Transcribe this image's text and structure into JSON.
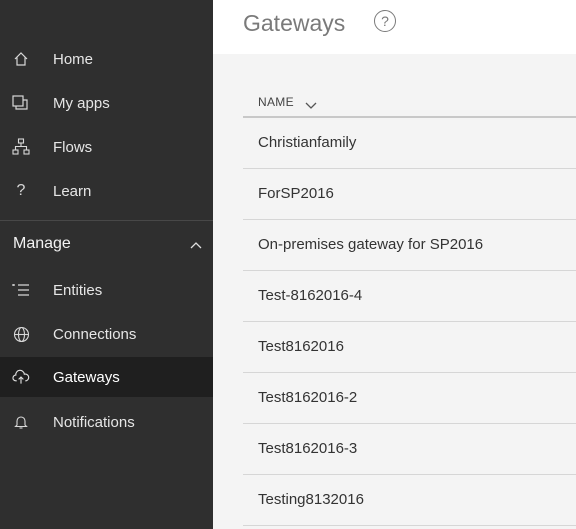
{
  "header": {
    "title": "Gateways",
    "help_glyph": "?"
  },
  "sidebar": {
    "items": [
      {
        "label": "Home",
        "icon": "home-icon"
      },
      {
        "label": "My apps",
        "icon": "my-apps-icon"
      },
      {
        "label": "Flows",
        "icon": "flows-icon"
      },
      {
        "label": "Learn",
        "icon": "question-icon"
      }
    ],
    "manage_section": {
      "label": "Manage",
      "expanded": true,
      "items": [
        {
          "label": "Entities",
          "icon": "list-icon"
        },
        {
          "label": "Connections",
          "icon": "globe-icon"
        },
        {
          "label": "Gateways",
          "icon": "cloud-upload-icon",
          "active": true
        },
        {
          "label": "Notifications",
          "icon": "bell-icon"
        }
      ]
    }
  },
  "table": {
    "column": "NAME",
    "rows": [
      "Christianfamily",
      "ForSP2016",
      "On-premises gateway for SP2016",
      "Test-8162016-4",
      "Test8162016",
      "Test8162016-2",
      "Test8162016-3",
      "Testing8132016"
    ]
  }
}
